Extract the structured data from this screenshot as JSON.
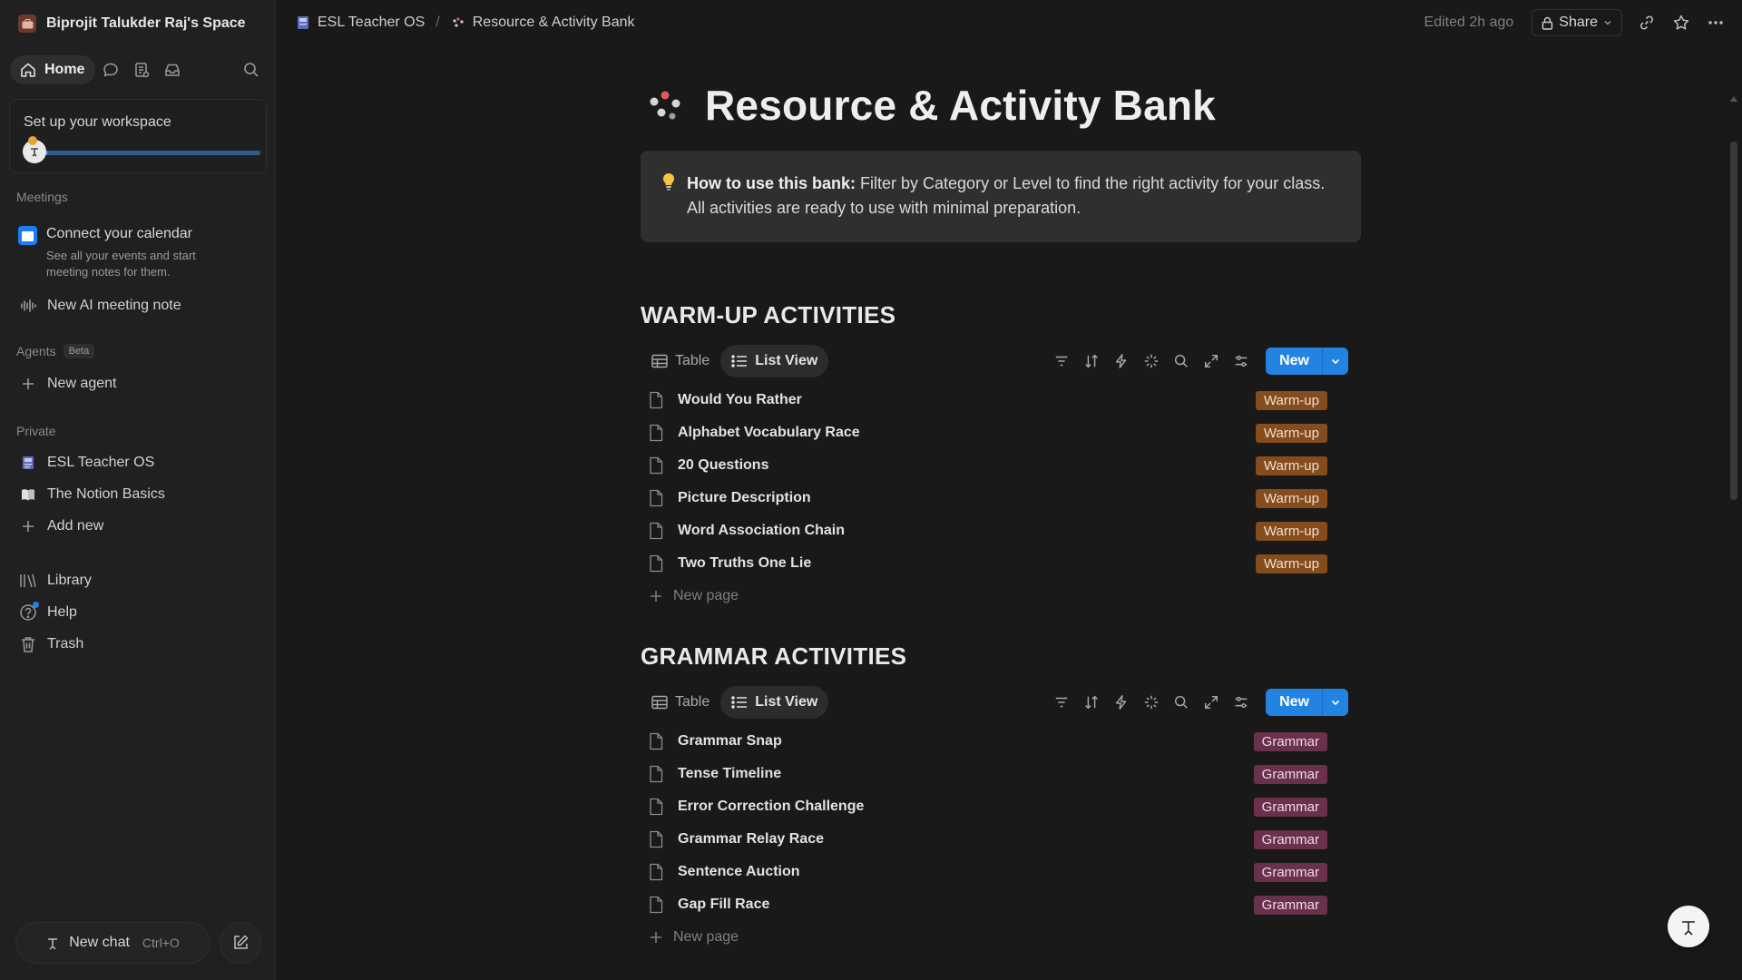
{
  "workspace": {
    "name": "Biprojit Talukder Raj's Space"
  },
  "nav": {
    "home_label": "Home"
  },
  "setup": {
    "title": "Set up your workspace",
    "progress": 0.05
  },
  "meetings": {
    "label": "Meetings",
    "calendar_title": "Connect your calendar",
    "calendar_sub": "See all your events and start meeting notes for them.",
    "ai_note": "New AI meeting note"
  },
  "agents": {
    "label": "Agents",
    "badge": "Beta",
    "new_agent": "New agent"
  },
  "private": {
    "label": "Private",
    "items": [
      {
        "label": "ESL Teacher OS"
      },
      {
        "label": "The Notion Basics"
      }
    ],
    "add_new": "Add new"
  },
  "bottom_nav": {
    "library": "Library",
    "help": "Help",
    "trash": "Trash"
  },
  "chat": {
    "label": "New chat",
    "shortcut": "Ctrl+O"
  },
  "topbar": {
    "breadcrumbs": [
      "ESL Teacher OS",
      "Resource & Activity Bank"
    ],
    "separator": "/",
    "edited": "Edited 2h ago",
    "share": "Share"
  },
  "page": {
    "title": "Resource & Activity Bank",
    "callout_bold": "How to use this bank:",
    "callout_text": " Filter by Category or Level to find the right activity for your class. All activities are ready to use with minimal preparation."
  },
  "sections": [
    {
      "title": "WARM-UP ACTIVITIES",
      "tabs": [
        "Table",
        "List View"
      ],
      "new_label": "New",
      "tag": "Warm-up",
      "items": [
        "Would You Rather",
        "Alphabet Vocabulary Race",
        "20 Questions",
        "Picture Description",
        "Word Association Chain",
        "Two Truths One Lie"
      ],
      "new_page": "New page"
    },
    {
      "title": "GRAMMAR ACTIVITIES",
      "tabs": [
        "Table",
        "List View"
      ],
      "new_label": "New",
      "tag": "Grammar",
      "items": [
        "Grammar Snap",
        "Tense Timeline",
        "Error Correction Challenge",
        "Grammar Relay Race",
        "Sentence Auction",
        "Gap Fill Race"
      ],
      "new_page": "New page"
    }
  ],
  "colors": {
    "accent": "#2383e2",
    "warmup_tag": "#854c1d",
    "grammar_tag": "#69314c",
    "background": "#191919",
    "sidebar": "#202020"
  }
}
